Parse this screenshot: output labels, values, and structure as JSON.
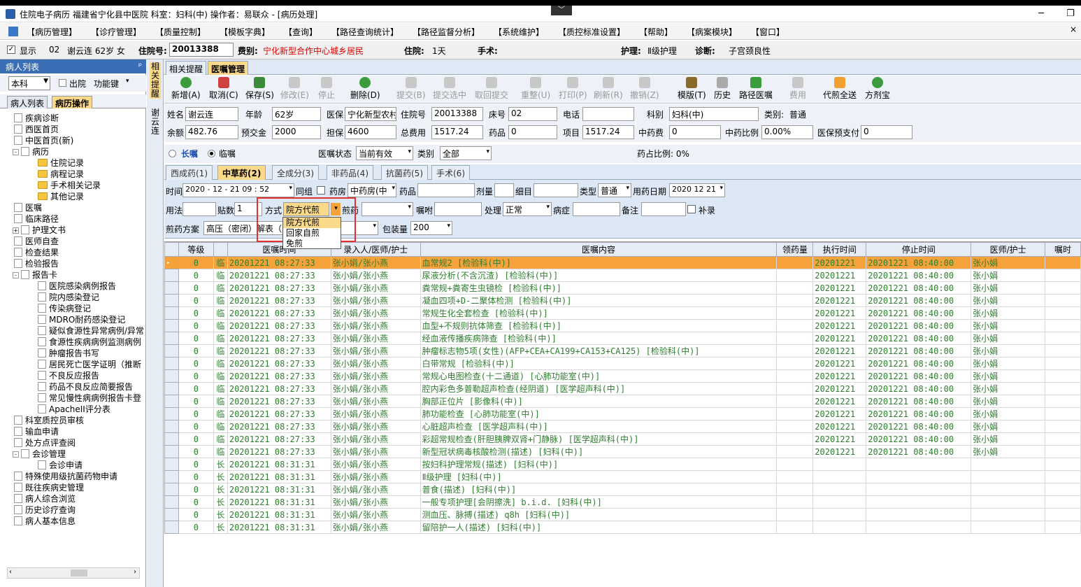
{
  "title_bar": {
    "text": "住院电子病历  福建省宁化县中医院  科室：妇科(中)  操作者：易联众 - [病历处理]",
    "min": "─",
    "restore": "❐"
  },
  "menu": [
    "【病历管理】",
    "【诊疗管理】",
    "【质量控制】",
    "【模板字典】",
    "【查询】",
    "【路径查询统计】",
    "【路径监督分析】",
    "【系统维护】",
    "【质控标准设置】",
    "【帮助】",
    "【病案模块】",
    "【窗口】"
  ],
  "patient_bar": {
    "show_label": "显示",
    "bed": "02",
    "name_age_sex": "谢云连 62岁 女",
    "admission_label": "住院号:",
    "admission_no": "20013388",
    "fee_label": "费别:",
    "fee": "宁化新型合作中心城乡居民",
    "stay_label": "住院:",
    "stay": "1天",
    "surgery_label": "手术:",
    "nursing_label": "护理:",
    "nursing": "Ⅱ级护理",
    "diag_label": "诊断:",
    "diagnosis": "子宫颈良性"
  },
  "left_panel": {
    "title": "病人列表",
    "pin": "ᵖ",
    "dept": "本科",
    "discharge": "出院",
    "func_key": "功能键",
    "tabs": [
      "病人列表",
      "病历操作"
    ],
    "tree": [
      "疾病诊断",
      "西医首页",
      "中医首页(新)",
      "病历",
      "住院记录",
      "病程记录",
      "手术相关记录",
      "其他记录",
      "医嘱",
      "临床路径",
      "护理文书",
      "医师自查",
      "检查结果",
      "检验报告",
      "报告卡",
      "医院感染病例报告",
      "院内感染登记",
      "传染病登记",
      "MDRO耐药感染登记",
      "疑似食源性异常病例/异常",
      "食源性疾病病例监测病例",
      "肿瘤报告书写",
      "居民死亡医学证明（推断",
      "不良反应报告",
      "药品不良反应简要报告",
      "常见慢性病病例报告卡登",
      "ApacheII评分表",
      "科室质控员审核",
      "输血申请",
      "处方点评查阅",
      "会诊管理",
      "会诊申请",
      "特殊使用级抗菌药物申请",
      "既往疾病史管理",
      "病人综合浏览",
      "历史诊疗查询",
      "病人基本信息"
    ]
  },
  "vertical_tabs": [
    "相关提醒",
    "谢云连"
  ],
  "main_tabs": [
    "相关提醒",
    "医嘱管理"
  ],
  "toolbar": [
    "新增(A)",
    "取消(C)",
    "保存(S)",
    "修改(E)",
    "停止",
    "删除(D)",
    "提交(B)",
    "提交选中",
    "取回提交",
    "重整(U)",
    "打印(P)",
    "刷新(R)",
    "撤销(Z)",
    "模版(T)",
    "历史",
    "路径医嘱",
    "费用",
    "代煎全送",
    "方剂宝"
  ],
  "form": {
    "name_l": "姓名",
    "name": "谢云连",
    "age_l": "年龄",
    "age": "62岁",
    "ins_l": "医保",
    "ins": "宁化新型农村",
    "adm_l": "住院号",
    "adm": "20013388",
    "bed_l": "床号",
    "bed": "02",
    "tel_l": "电话",
    "tel": "",
    "dept_l": "科别",
    "dept": "妇科(中)",
    "cat_l": "类别:",
    "cat": "普通",
    "bal_l": "余额",
    "bal": "482.76",
    "pre_l": "预交金",
    "pre": "2000",
    "guar_l": "担保",
    "guar": "4600",
    "total_l": "总费用",
    "total": "1517.24",
    "drug_l": "药品",
    "drug": "0",
    "item_l": "项目",
    "item": "1517.24",
    "tcm_l": "中药费",
    "tcm": "0",
    "tcmr_l": "中药比例",
    "tcmr": "0.00%",
    "insp_l": "医保预支付",
    "insp": "0"
  },
  "order_type": {
    "long": "长嘱",
    "temp": "临嘱",
    "status_l": "医嘱状态",
    "status": "当前有效",
    "cat_l": "类别",
    "cat": "全部",
    "ratio": "药占比例: 0%"
  },
  "category_tabs": [
    "西成药(1)",
    "中草药(2)",
    "全成分(3)",
    "非药品(4)",
    "抗菌药(5)",
    "手术(6)"
  ],
  "entry": {
    "time_l": "时间",
    "time": "2020 - 12 - 21  09 : 52",
    "group": "同组",
    "pharm_l": "药房",
    "pharm": "中药房(中",
    "drug_l": "药品",
    "dose_l": "剂量",
    "detail_l": "细目",
    "type_l": "类型",
    "type": "普通",
    "days_l": "用药日期",
    "days": "2020 12 21",
    "usage_l": "用法",
    "packs_l": "贴数",
    "packs": "1",
    "method_l": "方式",
    "method": "院方代煎",
    "predecoc_l": "煎药",
    "advice_l": "嘱咐",
    "proc_l": "处理",
    "proc": "正常",
    "sym_l": "病症",
    "note_l": "备注",
    "add": "补录",
    "scheme_l": "煎药方案",
    "scheme": "高压（密闭）解表（",
    "pack_l": "包装量",
    "pack": "200"
  },
  "dropdown_options": [
    "院方代煎",
    "回家自煎",
    "免煎"
  ],
  "grid": {
    "columns": [
      "等级",
      "",
      "医嘱时间",
      "录入人/医师/护士",
      "医嘱内容",
      "领药量",
      "执行时间",
      "停止时间",
      "医师/护士",
      "嘱时"
    ],
    "rows": [
      [
        "0",
        "临",
        "20201221 08:27:33",
        "张小娟/张小燕",
        "血常规2   [检验科(中)]",
        "",
        "20201221",
        "20201221 08:40:00",
        "张小娟"
      ],
      [
        "0",
        "临",
        "20201221 08:27:33",
        "张小娟/张小燕",
        "尿液分析(不含沉渣)    [检验科(中)]",
        "",
        "20201221",
        "20201221 08:40:00",
        "张小娟"
      ],
      [
        "0",
        "临",
        "20201221 08:27:33",
        "张小娟/张小燕",
        "粪常规+粪寄生虫镜检    [检验科(中)]",
        "",
        "20201221",
        "20201221 08:40:00",
        "张小娟"
      ],
      [
        "0",
        "临",
        "20201221 08:27:33",
        "张小娟/张小燕",
        "凝血四项+D-二聚体检测    [检验科(中)]",
        "",
        "20201221",
        "20201221 08:40:00",
        "张小娟"
      ],
      [
        "0",
        "临",
        "20201221 08:27:33",
        "张小娟/张小燕",
        "常规生化全套检查    [检验科(中)]",
        "",
        "20201221",
        "20201221 08:40:00",
        "张小娟"
      ],
      [
        "0",
        "临",
        "20201221 08:27:33",
        "张小娟/张小燕",
        "血型+不规则抗体筛查    [检验科(中)]",
        "",
        "20201221",
        "20201221 08:40:00",
        "张小娟"
      ],
      [
        "0",
        "临",
        "20201221 08:27:33",
        "张小娟/张小燕",
        "经血液传播疾病筛查    [检验科(中)]",
        "",
        "20201221",
        "20201221 08:40:00",
        "张小娟"
      ],
      [
        "0",
        "临",
        "20201221 08:27:33",
        "张小娟/张小燕",
        "肿瘤标志物5项(女性)(AFP+CEA+CA199+CA153+CA125)    [检验科(中)]",
        "",
        "20201221",
        "20201221 08:40:00",
        "张小娟"
      ],
      [
        "0",
        "临",
        "20201221 08:27:33",
        "张小娟/张小燕",
        "白带常规    [检验科(中)]",
        "",
        "20201221",
        "20201221 08:40:00",
        "张小娟"
      ],
      [
        "0",
        "临",
        "20201221 08:27:33",
        "张小娟/张小燕",
        "常规心电图检查(十二通道)    [心肺功能室(中)]",
        "",
        "20201221",
        "20201221 08:40:00",
        "张小娟"
      ],
      [
        "0",
        "临",
        "20201221 08:27:33",
        "张小娟/张小燕",
        "腔内彩色多普勒超声检查(经阴道)    [医学超声科(中)]",
        "",
        "20201221",
        "20201221 08:40:00",
        "张小娟"
      ],
      [
        "0",
        "临",
        "20201221 08:27:33",
        "张小娟/张小燕",
        "胸部正位片    [影像科(中)]",
        "",
        "20201221",
        "20201221 08:40:00",
        "张小娟"
      ],
      [
        "0",
        "临",
        "20201221 08:27:33",
        "张小娟/张小燕",
        "肺功能检查    [心肺功能室(中)]",
        "",
        "20201221",
        "20201221 08:40:00",
        "张小娟"
      ],
      [
        "0",
        "临",
        "20201221 08:27:33",
        "张小娟/张小燕",
        "心脏超声检查    [医学超声科(中)]",
        "",
        "20201221",
        "20201221 08:40:00",
        "张小娟"
      ],
      [
        "0",
        "临",
        "20201221 08:27:33",
        "张小娟/张小燕",
        "彩超常规检查(肝胆胰脾双肾+门静脉)    [医学超声科(中)]",
        "",
        "20201221",
        "20201221 08:40:00",
        "张小娟"
      ],
      [
        "0",
        "临",
        "20201221 08:27:33",
        "张小娟/张小燕",
        "新型冠状病毒核酸检测(描述)    [妇科(中)]",
        "",
        "20201221",
        "20201221 08:40:00",
        "张小娟"
      ],
      [
        "0",
        "长",
        "20201221 08:31:31",
        "张小娟/张小燕",
        "按妇科护理常规(描述)    [妇科(中)]",
        "",
        "",
        "",
        ""
      ],
      [
        "0",
        "长",
        "20201221 08:31:31",
        "张小娟/张小燕",
        "Ⅱ级护理    [妇科(中)]",
        "",
        "",
        "",
        ""
      ],
      [
        "0",
        "长",
        "20201221 08:31:31",
        "张小娟/张小燕",
        "普食(描述)    [妇科(中)]",
        "",
        "",
        "",
        ""
      ],
      [
        "0",
        "长",
        "20201221 08:31:31",
        "张小娟/张小燕",
        "一般专项护理[会阴擦洗]  b.i.d.  [妇科(中)]",
        "",
        "",
        "",
        ""
      ],
      [
        "0",
        "长",
        "20201221 08:31:31",
        "张小娟/张小燕",
        "测血压、脉搏(描述)  q8h  [妇科(中)]",
        "",
        "",
        "",
        ""
      ],
      [
        "0",
        "长",
        "20201221 08:31:31",
        "张小娟/张小燕",
        "留陪护一人(描述)    [妇科(中)]",
        "",
        "",
        "",
        ""
      ]
    ]
  }
}
